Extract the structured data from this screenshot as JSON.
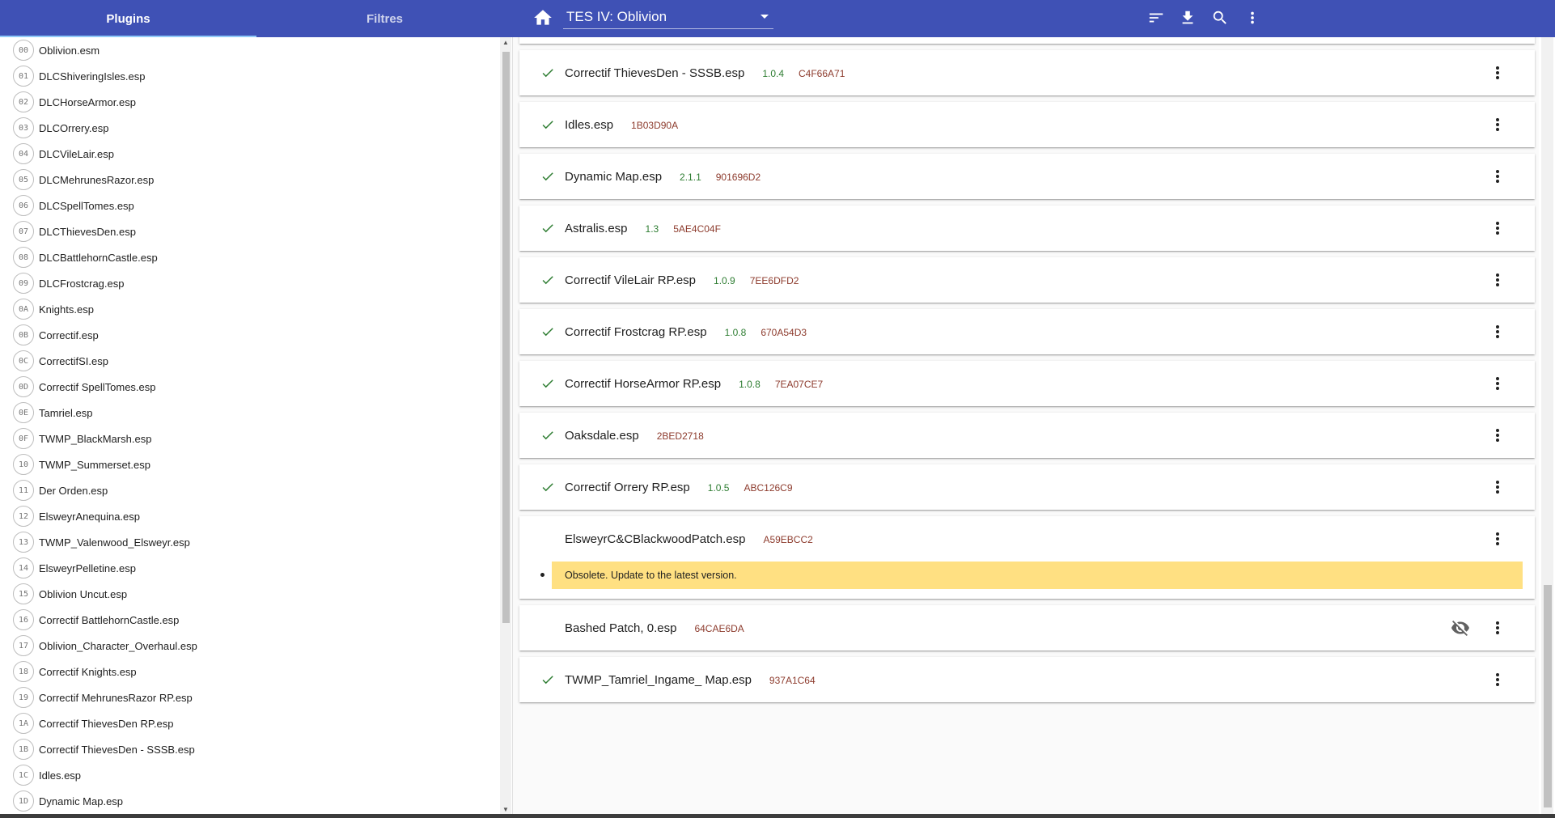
{
  "tabs": [
    {
      "label": "Plugins",
      "active": true
    },
    {
      "label": "Filtres",
      "active": false
    }
  ],
  "header": {
    "game": "TES IV: Oblivion",
    "icons": [
      "home-icon",
      "sort-icon",
      "download-icon",
      "search-icon",
      "more-vert-icon"
    ]
  },
  "load_order": [
    {
      "index": "00",
      "name": "Oblivion.esm"
    },
    {
      "index": "01",
      "name": "DLCShiveringIsles.esp"
    },
    {
      "index": "02",
      "name": "DLCHorseArmor.esp"
    },
    {
      "index": "03",
      "name": "DLCOrrery.esp"
    },
    {
      "index": "04",
      "name": "DLCVileLair.esp"
    },
    {
      "index": "05",
      "name": "DLCMehrunesRazor.esp"
    },
    {
      "index": "06",
      "name": "DLCSpellTomes.esp"
    },
    {
      "index": "07",
      "name": "DLCThievesDen.esp"
    },
    {
      "index": "08",
      "name": "DLCBattlehornCastle.esp"
    },
    {
      "index": "09",
      "name": "DLCFrostcrag.esp"
    },
    {
      "index": "0A",
      "name": "Knights.esp"
    },
    {
      "index": "0B",
      "name": "Correctif.esp"
    },
    {
      "index": "0C",
      "name": "CorrectifSI.esp"
    },
    {
      "index": "0D",
      "name": "Correctif SpellTomes.esp"
    },
    {
      "index": "0E",
      "name": "Tamriel.esp"
    },
    {
      "index": "0F",
      "name": "TWMP_BlackMarsh.esp"
    },
    {
      "index": "10",
      "name": "TWMP_Summerset.esp"
    },
    {
      "index": "11",
      "name": "Der Orden.esp"
    },
    {
      "index": "12",
      "name": "ElsweyrAnequina.esp"
    },
    {
      "index": "13",
      "name": "TWMP_Valenwood_Elsweyr.esp"
    },
    {
      "index": "14",
      "name": "ElsweyrPelletine.esp"
    },
    {
      "index": "15",
      "name": "Oblivion Uncut.esp"
    },
    {
      "index": "16",
      "name": "Correctif BattlehornCastle.esp"
    },
    {
      "index": "17",
      "name": "Oblivion_Character_Overhaul.esp"
    },
    {
      "index": "18",
      "name": "Correctif Knights.esp"
    },
    {
      "index": "19",
      "name": "Correctif MehrunesRazor RP.esp"
    },
    {
      "index": "1A",
      "name": "Correctif ThievesDen RP.esp"
    },
    {
      "index": "1B",
      "name": "Correctif ThievesDen - SSSB.esp"
    },
    {
      "index": "1C",
      "name": "Idles.esp"
    },
    {
      "index": "1D",
      "name": "Dynamic Map.esp"
    }
  ],
  "cards": [
    {
      "name": "Correctif ThievesDen - SSSB.esp",
      "version": "1.0.4",
      "crc": "C4F66A71",
      "active": true
    },
    {
      "name": "Idles.esp",
      "version": "",
      "crc": "1B03D90A",
      "active": true
    },
    {
      "name": "Dynamic Map.esp",
      "version": "2.1.1",
      "crc": "901696D2",
      "active": true
    },
    {
      "name": "Astralis.esp",
      "version": "1.3",
      "crc": "5AE4C04F",
      "active": true
    },
    {
      "name": "Correctif VileLair RP.esp",
      "version": "1.0.9",
      "crc": "7EE6DFD2",
      "active": true
    },
    {
      "name": "Correctif Frostcrag RP.esp",
      "version": "1.0.8",
      "crc": "670A54D3",
      "active": true
    },
    {
      "name": "Correctif HorseArmor RP.esp",
      "version": "1.0.8",
      "crc": "7EA07CE7",
      "active": true
    },
    {
      "name": "Oaksdale.esp",
      "version": "",
      "crc": "2BED2718",
      "active": true
    },
    {
      "name": "Correctif Orrery RP.esp",
      "version": "1.0.5",
      "crc": "ABC126C9",
      "active": true
    },
    {
      "name": "ElsweyrC&CBlackwoodPatch.esp",
      "version": "",
      "crc": "A59EBCC2",
      "active": false,
      "message": "Obsolete. Update to the latest version."
    },
    {
      "name": "Bashed Patch, 0.esp",
      "version": "",
      "crc": "64CAE6DA",
      "active": false,
      "hidden_icon": "eye-off-icon"
    },
    {
      "name": "TWMP_Tamriel_Ingame_ Map.esp",
      "version": "",
      "crc": "937A1C64",
      "active": true
    }
  ],
  "colors": {
    "primary": "#3f51b5",
    "check": "#2e7d32",
    "warning": "#ffe082"
  }
}
